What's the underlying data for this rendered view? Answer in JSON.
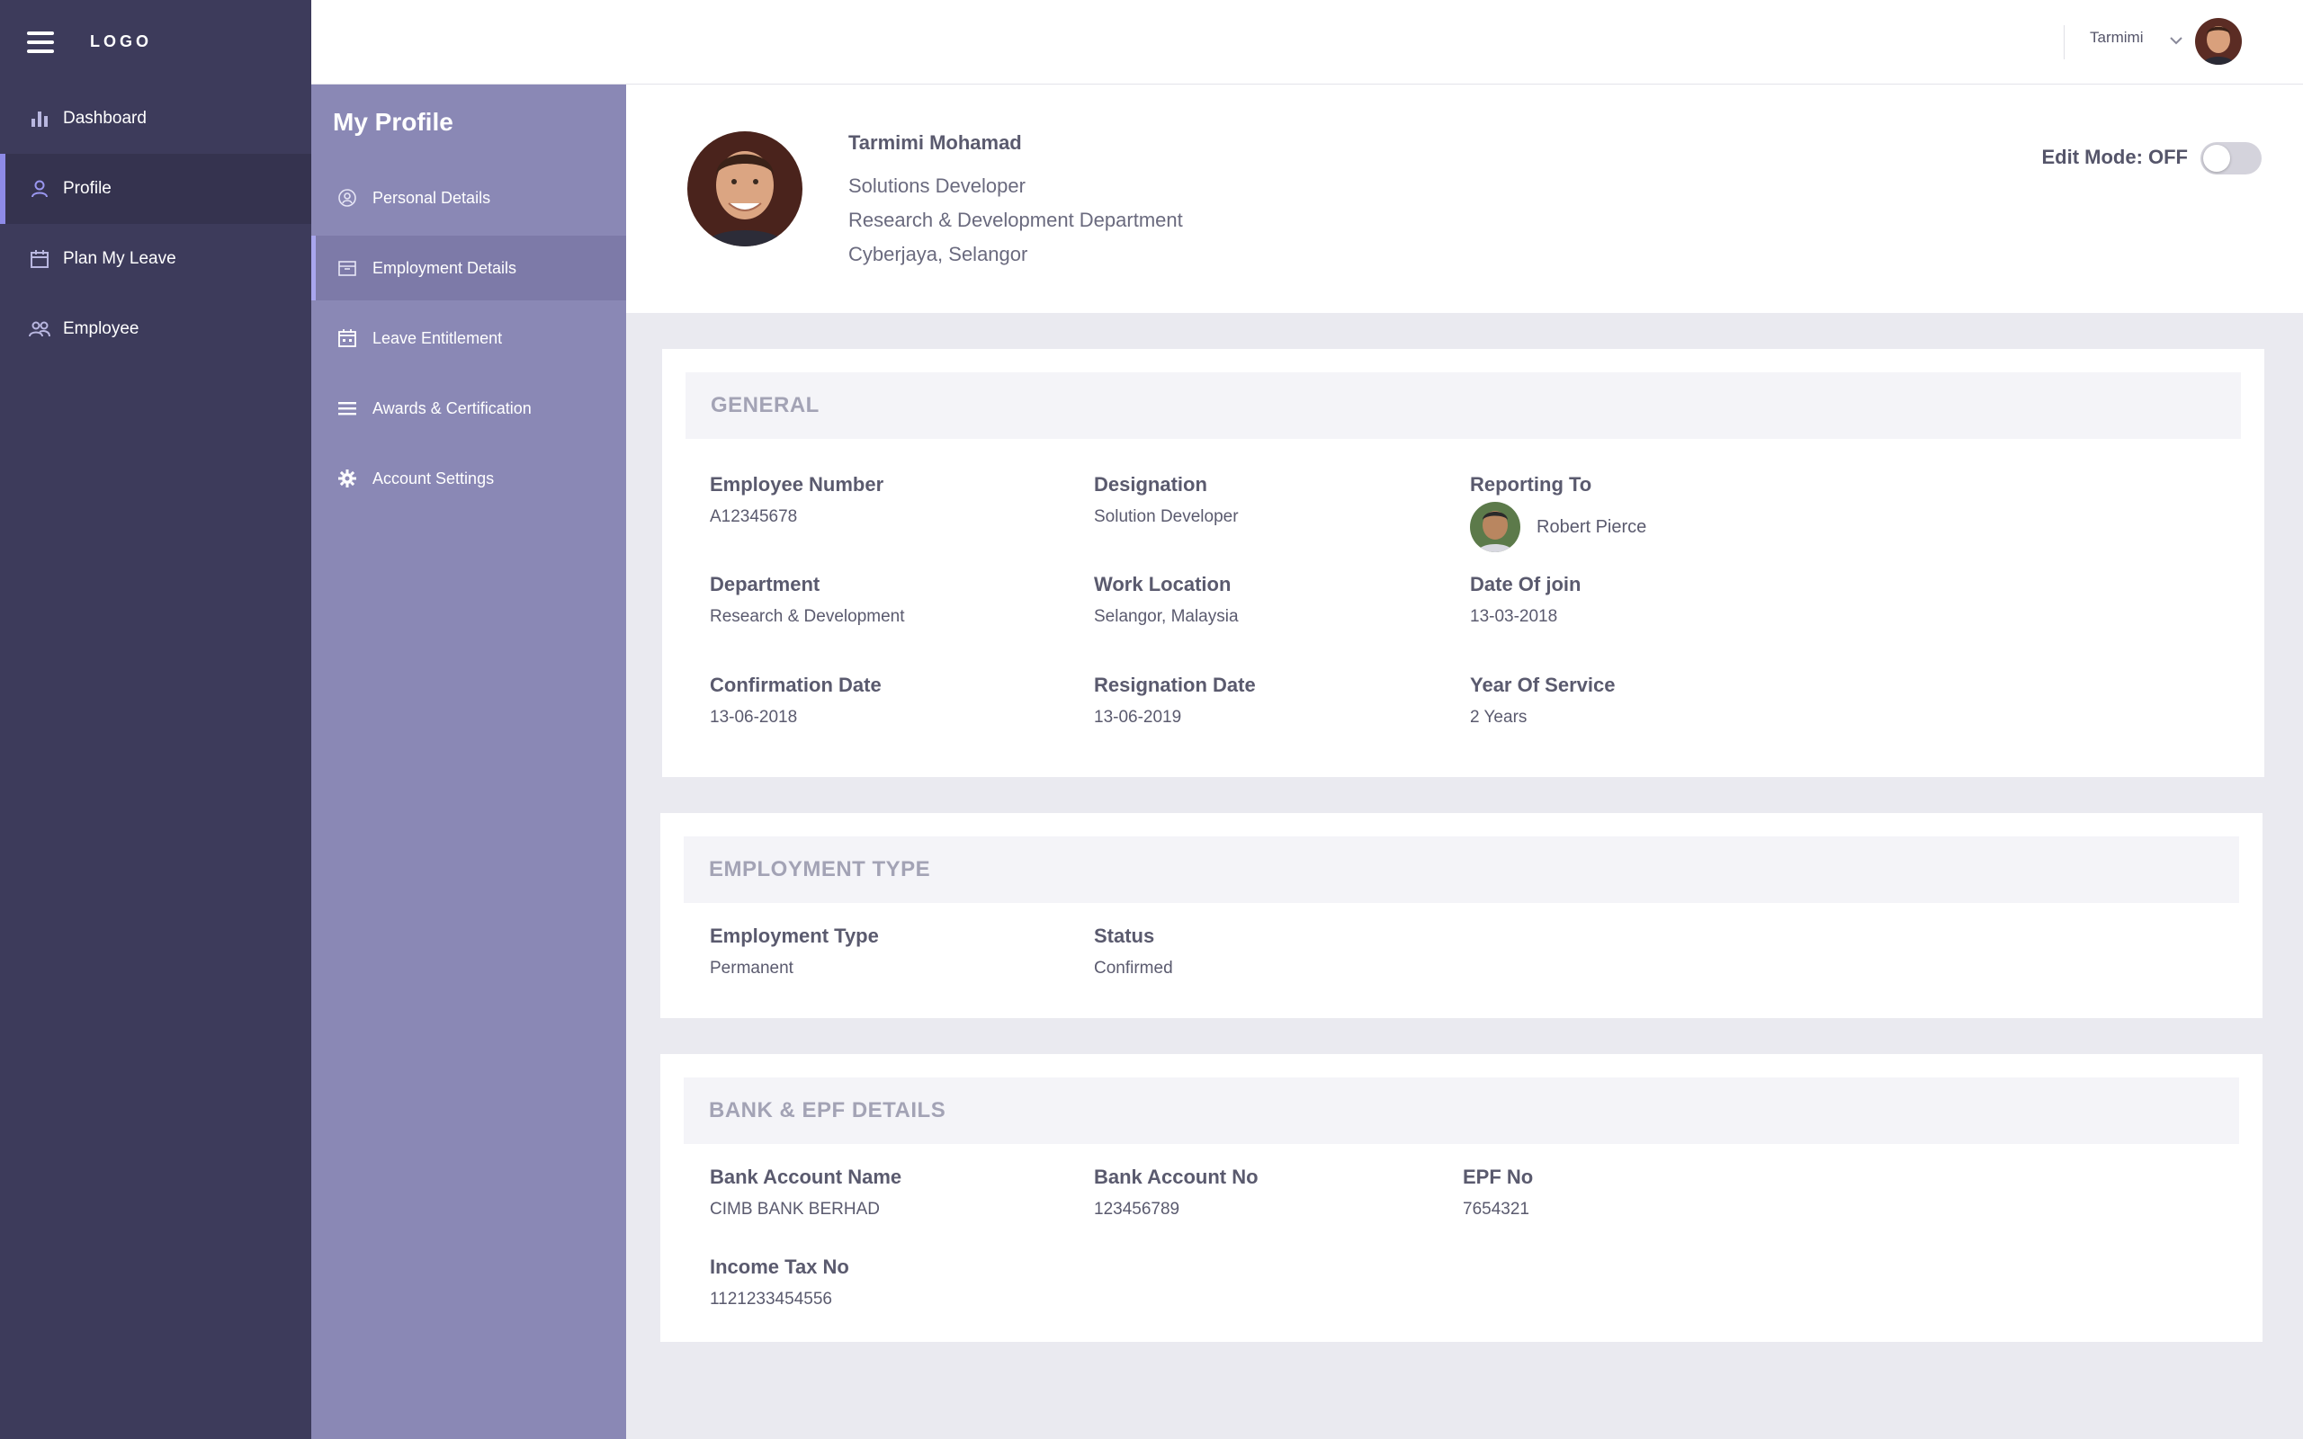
{
  "app": {
    "logo": "LOGO"
  },
  "sidebar": {
    "items": [
      {
        "label": "Dashboard",
        "icon": "bar-chart-icon"
      },
      {
        "label": "Profile",
        "icon": "user-icon"
      },
      {
        "label": "Plan My Leave",
        "icon": "calendar-icon"
      },
      {
        "label": "Employee",
        "icon": "users-icon"
      }
    ],
    "active": "Profile",
    "accent": "#8e8be8"
  },
  "header": {
    "username": "Tarmimi"
  },
  "subnav": {
    "title": "My Profile",
    "items": [
      {
        "label": "Personal Details",
        "icon": "id-icon"
      },
      {
        "label": "Employment Details",
        "icon": "briefcase-icon"
      },
      {
        "label": "Leave Entitlement",
        "icon": "calendar-icon"
      },
      {
        "label": "Awards & Certification",
        "icon": "list-icon"
      },
      {
        "label": "Account Settings",
        "icon": "gear-icon"
      }
    ],
    "active": "Employment Details"
  },
  "profile": {
    "name": "Tarmimi Mohamad",
    "title": "Solutions Developer",
    "department": "Research & Development Department",
    "location": "Cyberjaya, Selangor",
    "edit_mode_label": "Edit Mode: OFF",
    "edit_mode_on": false
  },
  "general": {
    "title": "GENERAL",
    "employee_number": {
      "label": "Employee Number",
      "value": "A12345678"
    },
    "designation": {
      "label": "Designation",
      "value": "Solution Developer"
    },
    "reporting_to": {
      "label": "Reporting To",
      "value": "Robert Pierce"
    },
    "department": {
      "label": "Department",
      "value": "Research & Development"
    },
    "work_location": {
      "label": "Work Location",
      "value": "Selangor, Malaysia"
    },
    "date_of_join": {
      "label": "Date Of join",
      "value": "13-03-2018"
    },
    "confirmation_date": {
      "label": "Confirmation Date",
      "value": "13-06-2018"
    },
    "resignation_date": {
      "label": "Resignation Date",
      "value": "13-06-2019"
    },
    "year_of_service": {
      "label": "Year Of Service",
      "value": "2 Years"
    }
  },
  "employment_type": {
    "title": "EMPLOYMENT TYPE",
    "type": {
      "label": "Employment Type",
      "value": "Permanent"
    },
    "status": {
      "label": "Status",
      "value": "Confirmed"
    }
  },
  "bank": {
    "title": "BANK & EPF DETAILS",
    "account_name": {
      "label": "Bank Account Name",
      "value": "CIMB BANK BERHAD"
    },
    "account_no": {
      "label": "Bank Account No",
      "value": "123456789"
    },
    "epf_no": {
      "label": "EPF No",
      "value": "7654321"
    },
    "income_tax_no": {
      "label": "Income Tax No",
      "value": "1121233454556"
    }
  }
}
